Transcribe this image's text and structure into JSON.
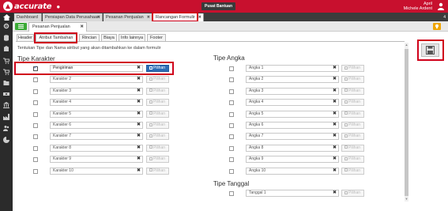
{
  "app": {
    "logo_text": "accurate",
    "logo_sub": "online",
    "help_label": "Pusat Bantuan"
  },
  "user": {
    "name": "April",
    "company": "Michele Ardent"
  },
  "main_tabs": [
    {
      "label": "Dashboard"
    },
    {
      "label": "Persiapan Data Perusahaan"
    },
    {
      "label": "Pesanan Penjualan"
    },
    {
      "label": "Rancangan Formulir"
    }
  ],
  "tab_count": "4",
  "document_tab": {
    "label": "Pesanan Penjualan"
  },
  "sub_tabs": [
    "Header",
    "Atribut Tambahan",
    "Rincian",
    "Biaya",
    "Info lainnya",
    "Footer"
  ],
  "description": "Tentukan Tipe dan Nama atribut yang akan ditambahkan ke dalam formulir",
  "tipe_karakter": {
    "title": "Tipe Karakter",
    "button_label": "Pilihan",
    "rows": [
      {
        "value": "Pengiriman",
        "placeholder": "Karakter 1",
        "checked": true
      },
      {
        "value": "",
        "placeholder": "Karakter 2",
        "checked": false
      },
      {
        "value": "",
        "placeholder": "Karakter 3",
        "checked": false
      },
      {
        "value": "",
        "placeholder": "Karakter 4",
        "checked": false
      },
      {
        "value": "",
        "placeholder": "Karakter 5",
        "checked": false
      },
      {
        "value": "",
        "placeholder": "Karakter 6",
        "checked": false
      },
      {
        "value": "",
        "placeholder": "Karakter 7",
        "checked": false
      },
      {
        "value": "",
        "placeholder": "Karakter 8",
        "checked": false
      },
      {
        "value": "",
        "placeholder": "Karakter 9",
        "checked": false
      },
      {
        "value": "",
        "placeholder": "Karakter 10",
        "checked": false
      }
    ]
  },
  "tipe_angka": {
    "title": "Tipe Angka",
    "button_label": "Pilihan",
    "rows": [
      {
        "placeholder": "Angka 1"
      },
      {
        "placeholder": "Angka 2"
      },
      {
        "placeholder": "Angka 3"
      },
      {
        "placeholder": "Angka 4"
      },
      {
        "placeholder": "Angka 5"
      },
      {
        "placeholder": "Angka 6"
      },
      {
        "placeholder": "Angka 7"
      },
      {
        "placeholder": "Angka 8"
      },
      {
        "placeholder": "Angka 9"
      },
      {
        "placeholder": "Angka 10"
      }
    ]
  },
  "tipe_tanggal": {
    "title": "Tipe Tanggal",
    "button_label": "Pilihan",
    "rows": [
      {
        "placeholder": "Tanggal 1"
      }
    ]
  },
  "clear_glyph": "✖",
  "close_glyph": "✖",
  "colors": {
    "brand_red": "#c8102e",
    "accent_blue": "#2d6db5",
    "highlight_red": "#d0021b",
    "green": "#3aaa35",
    "warning": "#f0a500"
  }
}
